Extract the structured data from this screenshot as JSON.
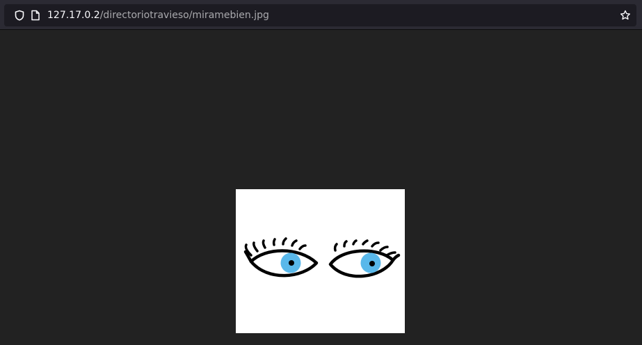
{
  "browser": {
    "url_host": "127.17.0.2",
    "url_path": "/directoriotravieso/miramebien.jpg",
    "icons": {
      "security": "shield-icon",
      "page": "page-icon",
      "bookmark": "star-icon"
    }
  },
  "viewer": {
    "background_color": "#222222"
  },
  "image": {
    "subject": "two cartoon eyes with eyelashes and blue irises",
    "iris_color": "#59b8ea",
    "outline_color": "#000000",
    "background_color": "#ffffff"
  }
}
